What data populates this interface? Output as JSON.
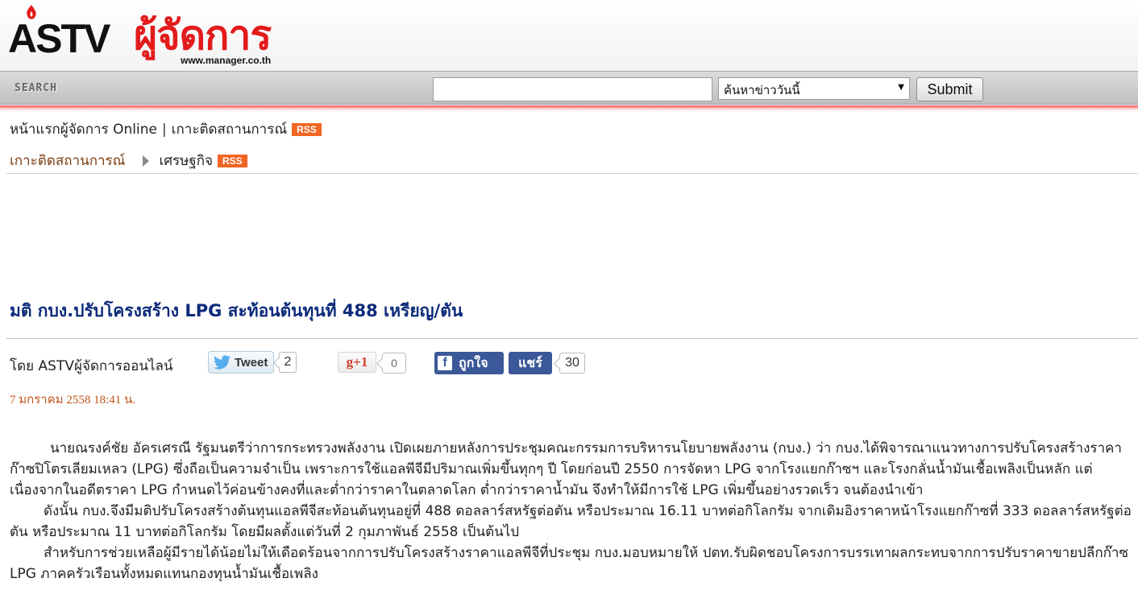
{
  "header": {
    "logo_text": "ASTV",
    "logo_brand": "ผู้จัดการ",
    "logo_url": "www.manager.co.th"
  },
  "search": {
    "label": "SEARCH",
    "input_value": "",
    "select_value": "ค้นหาข่าววันนี้",
    "submit_label": "Submit"
  },
  "nav": {
    "home_link": "หน้าแรกผู้จัดการ Online",
    "separator": "|",
    "section_link": "เกาะติดสถานการณ์",
    "rss_label": "RSS"
  },
  "breadcrumb": {
    "parent": "เกาะติดสถานการณ์",
    "current": "เศรษฐกิจ",
    "rss_label": "RSS"
  },
  "article": {
    "headline": "มติ กบง.ปรับโครงสร้าง LPG สะท้อนต้นทุนที่ 488 เหรียญ/ตัน",
    "byline": "โดย ASTVผู้จัดการออนไลน์",
    "date": "7 มกราคม 2558 18:41 น.",
    "paragraphs": [
      "นายณรงค์ชัย อัครเศรณี รัฐมนตรีว่าการกระทรวงพลังงาน เปิดเผยภายหลังการประชุมคณะกรรมการบริหารนโยบายพลังงาน (กบง.) ว่า กบง.ได้พิจารณาแนวทางการปรับโครงสร้างราคาก๊าซปิโตรเลียมเหลว (LPG) ซึ่งถือเป็นความจำเป็น เพราะการใช้แอลพีจีมีปริมาณเพิ่มขึ้นทุกๆ ปี โดยก่อนปี 2550 การจัดหา LPG จากโรงแยกก๊าซฯ และโรงกลั่นน้ำมันเชื้อเพลิงเป็นหลัก แต่เนื่องจากในอดีตราคา LPG กำหนดไว้ค่อนข้างคงที่และต่ำกว่าราคาในตลาดโลก ต่ำกว่าราคาน้ำมัน จึงทำให้มีการใช้ LPG เพิ่มขึ้นอย่างรวดเร็ว จนต้องนำเข้า",
      "ดังนั้น กบง.จึงมีมติปรับโครงสร้างต้นทุนแอลพีจีสะท้อนต้นทุนอยู่ที่ 488 ดอลลาร์สหรัฐต่อตัน หรือประมาณ 16.11 บาทต่อกิโลกรัม จากเดิมอิงราคาหน้าโรงแยกก๊าซที่ 333 ดอลลาร์สหรัฐต่อตัน หรือประมาณ 11 บาทต่อกิโลกรัม โดยมีผลตั้งแต่วันที่ 2 กุมภาพันธ์ 2558 เป็นต้นไป",
      "สำหรับการช่วยเหลือผู้มีรายได้น้อยไม่ให้เดือดร้อนจากการปรับโครงสร้างราคาแอลพีจีที่ประชุม กบง.มอบหมายให้ ปตท.รับผิดชอบโครงการบรรเทาผลกระทบจากการปรับราคาขายปลีกก๊าซ LPG ภาคครัวเรือนทั้งหมดแทนกองทุนน้ำมันเชื้อเพลิง"
    ]
  },
  "social": {
    "tweet_label": "Tweet",
    "tweet_count": "2",
    "gplus_label": "g+1",
    "gplus_count": "0",
    "fb_like_label": "ถูกใจ",
    "fb_share_label": "แชร์",
    "fb_count": "30"
  },
  "colors": {
    "brand_red": "#e31b1b",
    "headline_blue": "#0c2a7a",
    "rss_orange": "#f26522",
    "facebook_blue": "#3b5998",
    "date_orange": "#c0561a"
  }
}
